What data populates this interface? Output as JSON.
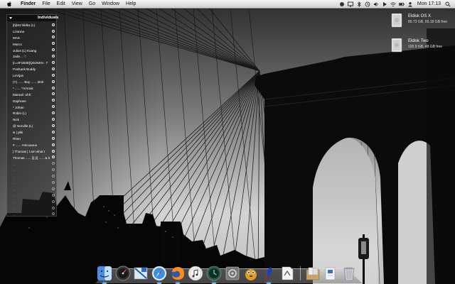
{
  "menubar": {
    "app_name": "Finder",
    "menus": [
      "File",
      "Edit",
      "View",
      "Go",
      "Window",
      "Help"
    ],
    "clock": "Mon 17:13",
    "status_icons": [
      "spotlight-like-icon",
      "display-icon",
      "bluetooth-icon",
      "time-machine-icon",
      "volume-icon",
      "play-icon",
      "wifi-icon",
      "battery-icon",
      "user-icon",
      "spotlight-icon"
    ]
  },
  "contacts_widget": {
    "title": "Individuals",
    "contacts": [
      {
        "name": "[b]MJ.hlidka (L)",
        "dim": false
      },
      {
        "name": "Lizanna",
        "dim": false
      },
      {
        "name": "MAX",
        "dim": false
      },
      {
        "name": "Marco",
        "dim": false
      },
      {
        "name": "Julius (L) Kuang",
        "dim": false
      },
      {
        "name": "Jade... ♡",
        "dim": false
      },
      {
        "name": "[c=4F1B2E]QDJKEN . T",
        "dim": false
      },
      {
        "name": "Poshank Buddy",
        "dim": false
      },
      {
        "name": "LeVijas",
        "dim": false
      },
      {
        "name": "(Y) ...... Boy ...... 3mh",
        "dim": false
      },
      {
        "name": "* ...... ^Arnouk",
        "dim": false
      },
      {
        "name": "Manuel :ohh:",
        "dim": false
      },
      {
        "name": "Daphnee",
        "dim": false
      },
      {
        "name": "* Johan",
        "dim": false
      },
      {
        "name": "Robin (L)",
        "dim": false
      },
      {
        "name": "Nick",
        "dim": false
      },
      {
        "name": "@ Norville (L)",
        "dim": false
      },
      {
        "name": "is | pkk",
        "dim": false
      },
      {
        "name": "Rhen",
        "dim": false
      },
      {
        "name": "# ...... Anicuuuuu",
        "dim": false
      },
      {
        "name": "| Thomas | I am what I",
        "dim": false
      },
      {
        "name": "Thomas ...... [i] [i] ...... & le",
        "dim": false
      },
      {
        "name": "...",
        "dim": true
      },
      {
        "name": "...",
        "dim": true
      },
      {
        "name": "...",
        "dim": true
      },
      {
        "name": "...",
        "dim": true
      },
      {
        "name": "...",
        "dim": true
      },
      {
        "name": "...",
        "dim": true
      },
      {
        "name": "...",
        "dim": true
      },
      {
        "name": "...",
        "dim": true
      },
      {
        "name": "...",
        "dim": true
      }
    ]
  },
  "drives": [
    {
      "name": "Eldisk OS X",
      "info": "85.72 GB, 65.18 GB free"
    },
    {
      "name": "Eldisk Two",
      "info": "100.9 GB, 48 GB free"
    }
  ],
  "dock": {
    "apps": [
      {
        "icon": "finder-icon",
        "running": true
      },
      {
        "icon": "dashboard-icon",
        "running": false
      },
      {
        "icon": "mail-icon",
        "running": false
      },
      {
        "icon": "safari-icon",
        "running": true
      },
      {
        "icon": "firefox-icon",
        "running": true
      },
      {
        "icon": "itunes-icon",
        "running": false
      },
      {
        "icon": "time-machine-icon",
        "running": true
      },
      {
        "icon": "utility-icon",
        "running": false
      },
      {
        "icon": "adium-icon",
        "running": false
      },
      {
        "icon": "quill-icon",
        "running": true
      },
      {
        "icon": "script-icon",
        "running": false
      }
    ],
    "stacks": [
      {
        "icon": "downloads-stack-icon"
      },
      {
        "icon": "documents-stack-icon"
      },
      {
        "icon": "trash-icon"
      }
    ]
  },
  "colors": {
    "menubar": "#dcdcdc",
    "running_light": "#8cc8ff"
  }
}
